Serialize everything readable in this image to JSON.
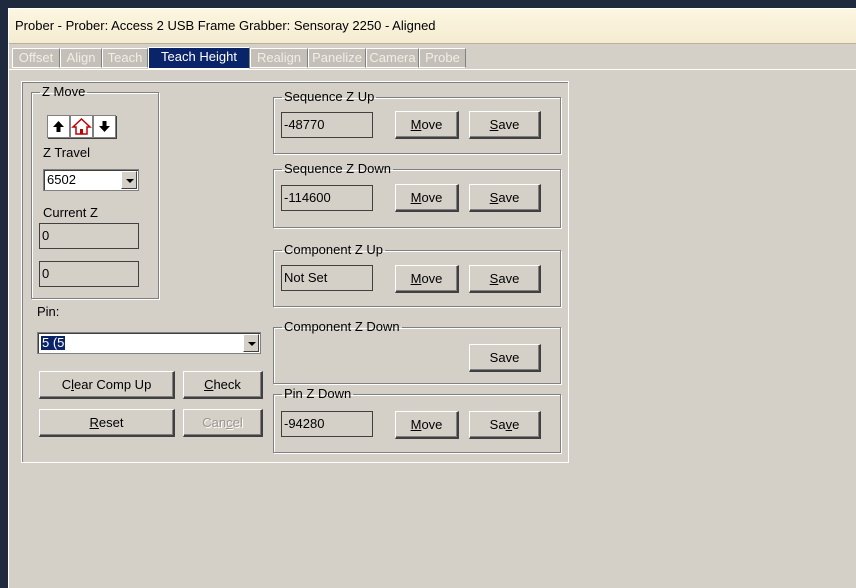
{
  "window": {
    "title": "Prober - Prober: Access 2 USB Frame Grabber: Sensoray 2250 - Aligned"
  },
  "tabs": [
    "Offset",
    "Align",
    "Teach",
    "Teach Height",
    "Realign",
    "Panelize",
    "Camera",
    "Probe"
  ],
  "active_tab": "Teach Height",
  "zmove": {
    "legend": "Z Move",
    "up_icon": "arrow-up-icon",
    "home_icon": "home-icon",
    "down_icon": "arrow-down-icon",
    "travel_label": "Z Travel",
    "travel_value": "6502",
    "current_label": "Current Z",
    "current_value_1": "0",
    "current_value_2": "0"
  },
  "pin": {
    "label": "Pin:",
    "value": "5 (5"
  },
  "buttons": {
    "clear_comp_up_pre": "C",
    "clear_comp_up_u": "l",
    "clear_comp_up_post": "ear Comp Up",
    "check_u": "C",
    "check_post": "heck",
    "reset_u": "R",
    "reset_post": "eset",
    "cancel_pre": "Can",
    "cancel_u": "c",
    "cancel_post": "el"
  },
  "groups": {
    "seq_z_up": {
      "legend": "Sequence Z Up",
      "value": "-48770"
    },
    "seq_z_down": {
      "legend": "Sequence Z Down",
      "value": "-114600"
    },
    "comp_z_up": {
      "legend": "Component Z Up",
      "value": "Not Set"
    },
    "comp_z_down": {
      "legend": "Component Z Down"
    },
    "pin_z_down": {
      "legend": "Pin Z Down",
      "value": "-94280"
    }
  },
  "common": {
    "move_u": "M",
    "move_post": "ove",
    "save_u": "S",
    "save_post": "ave",
    "save_plain": "Save",
    "save_pin_pre": "Sa",
    "save_pin_u": "v",
    "save_pin_post": "e"
  },
  "colors": {
    "active_tab": "#0a246a",
    "face": "#d4d0c8",
    "desktop": "#1f2a3e"
  }
}
